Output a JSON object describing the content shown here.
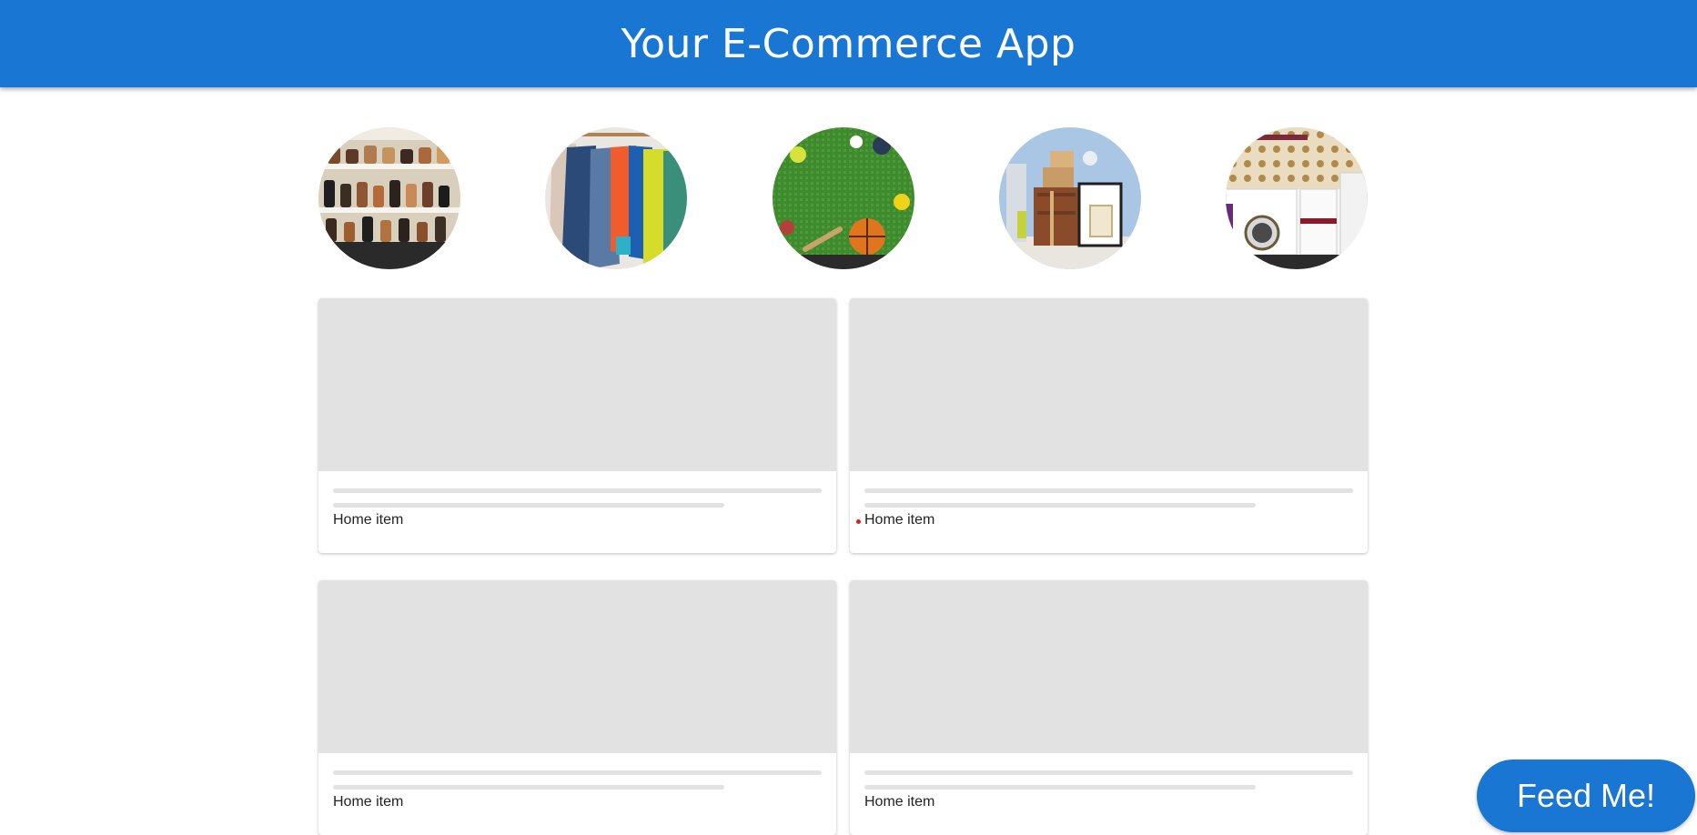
{
  "header": {
    "title": "Your E-Commerce App"
  },
  "categories": [
    {
      "icon": "shoes-category-icon"
    },
    {
      "icon": "clothing-category-icon"
    },
    {
      "icon": "sports-category-icon"
    },
    {
      "icon": "home-goods-category-icon"
    },
    {
      "icon": "appliances-category-icon"
    }
  ],
  "products": [
    {
      "label": "Home item",
      "dot": false
    },
    {
      "label": "Home item",
      "dot": true
    },
    {
      "label": "Home item",
      "dot": false
    },
    {
      "label": "Home item",
      "dot": false
    }
  ],
  "feed_button": {
    "label": "Feed Me!"
  },
  "colors": {
    "header": "#1976d2",
    "placeholder": "#e2e2e2",
    "notification_dot": "#e0201b"
  }
}
